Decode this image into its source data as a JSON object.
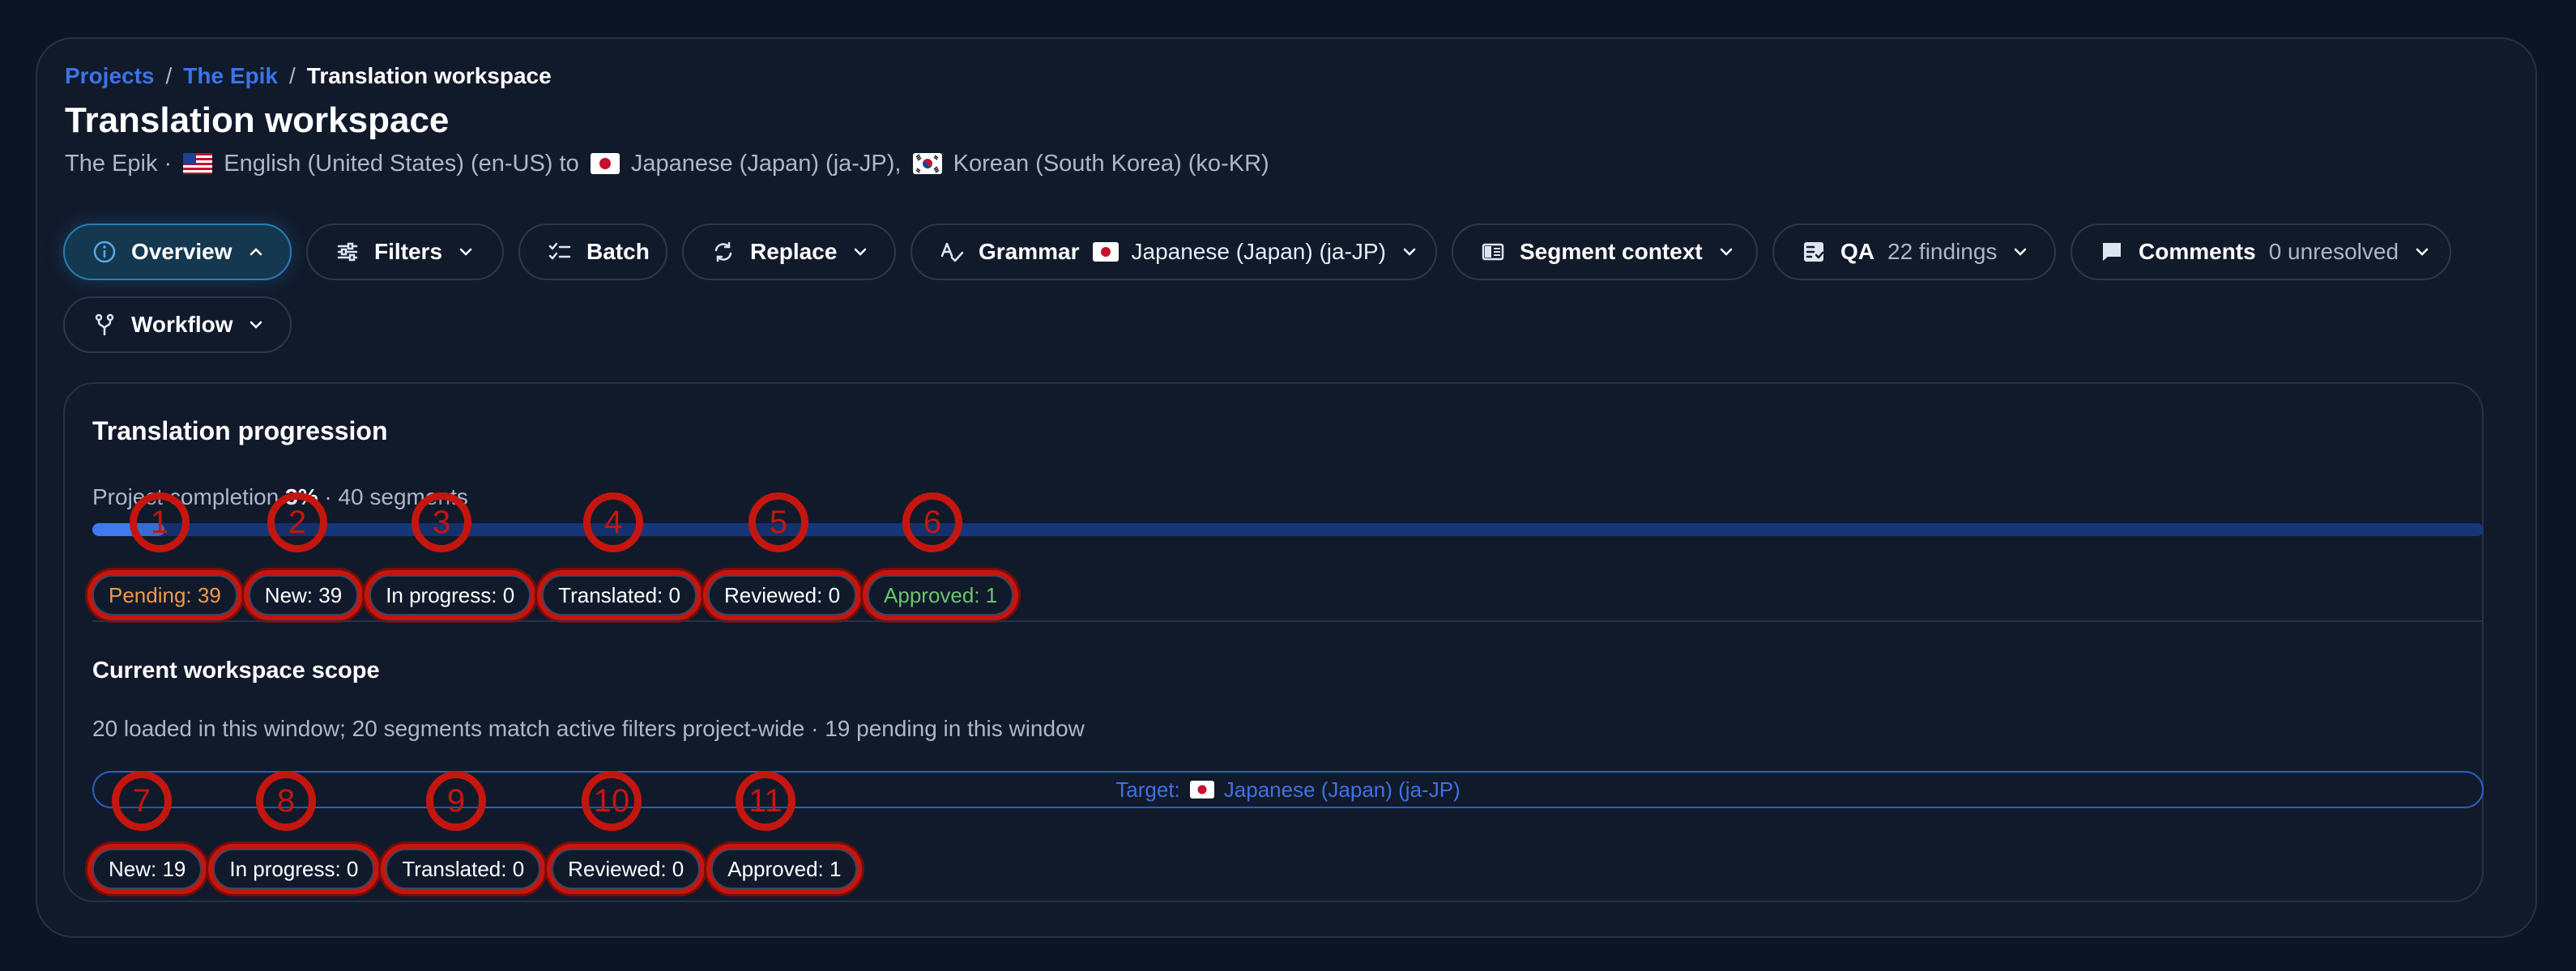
{
  "breadcrumb": {
    "projects": "Projects",
    "project": "The Epik",
    "current": "Translation workspace"
  },
  "header": {
    "title": "Translation workspace",
    "subtitle_project": "The Epik ·",
    "source_lang": "English (United States) (en-US) to",
    "target_lang_1": "Japanese (Japan) (ja-JP),",
    "target_lang_2": "Korean (South Korea) (ko-KR)"
  },
  "toolbar": {
    "overview": "Overview",
    "filters": "Filters",
    "batch": "Batch",
    "replace": "Replace",
    "grammar": "Grammar",
    "grammar_lang": "Japanese (Japan) (ja-JP)",
    "segment_context": "Segment context",
    "qa": "QA",
    "qa_findings": "22 findings",
    "comments": "Comments",
    "comments_unresolved": "0 unresolved",
    "workflow": "Workflow"
  },
  "progression": {
    "title": "Translation progression",
    "completion_prefix": "Project completion",
    "completion_value": "3%",
    "completion_suffix": "· 40 segments",
    "progress_percent": 3,
    "chips": {
      "pending": "Pending: 39",
      "new": "New: 39",
      "in_progress": "In progress: 0",
      "translated": "Translated: 0",
      "reviewed": "Reviewed: 0",
      "approved": "Approved: 1"
    }
  },
  "scope": {
    "title": "Current workspace scope",
    "summary": "20 loaded in this window; 20 segments match active filters project-wide · 19 pending in this window",
    "target_prefix": "Target:",
    "target_lang": "Japanese (Japan) (ja-JP)",
    "chips": {
      "new": "New: 19",
      "in_progress": "In progress: 0",
      "translated": "Translated: 0",
      "reviewed": "Reviewed: 0",
      "approved": "Approved: 1"
    }
  },
  "markers": [
    "1",
    "2",
    "3",
    "4",
    "5",
    "6",
    "7",
    "8",
    "9",
    "10",
    "11"
  ],
  "colors": {
    "accent": "#3c73e6",
    "marker": "#c4160f",
    "pending": "#ef9a4a",
    "approved": "#6cc46c"
  }
}
